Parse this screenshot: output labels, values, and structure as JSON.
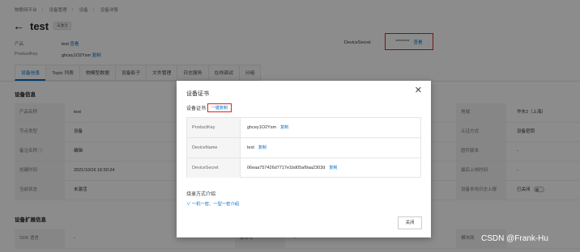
{
  "breadcrumb": [
    "物联网平台",
    "设备管理",
    "设备",
    "设备详情"
  ],
  "device": {
    "name": "test",
    "status": "未激活",
    "product_label": "产品",
    "product_value": "test",
    "product_link": "查看",
    "productkey_label": "ProductKey",
    "productkey_value": "ghcey1O2Ysm",
    "productkey_copy": "复制",
    "devicesecret_label": "DeviceSecret",
    "devicesecret_masked": "********",
    "devicesecret_view": "查看"
  },
  "tabs": [
    "设备信息",
    "Topic 列表",
    "物模型数据",
    "设备影子",
    "文件管理",
    "日志服务",
    "在线调试",
    "分组"
  ],
  "active_tab": 0,
  "section_info": {
    "title": "设备信息",
    "rows": [
      {
        "l1": "产品名称",
        "v1": "test",
        "l3": "地域",
        "v3": "华东2（上海）"
      },
      {
        "l1": "节点类型",
        "v1": "设备",
        "l3": "认证方式",
        "v3": "设备密钥"
      },
      {
        "l1": "备注名称",
        "v1": "编辑",
        "l3": "固件版本",
        "v3": "-"
      },
      {
        "l1": "创建时间",
        "v1": "2021/10/16 16:50:24",
        "l3": "最后上线时间",
        "v3": "-"
      },
      {
        "l1": "当前状态",
        "v1": "未激活",
        "l3": "设备本地日志上报",
        "v3": "已关闭"
      }
    ]
  },
  "section_ext": {
    "title": "设备扩展信息",
    "rows": [
      {
        "l1": "SDK 语言",
        "v1": "-",
        "l2": "版本号",
        "v2": "-",
        "l3": "模块商",
        "v3": ""
      }
    ]
  },
  "modal": {
    "title": "设备证书",
    "cert_label": "设备证书",
    "copy_all": "一键复制",
    "rows": [
      {
        "key": "ProductKey",
        "value": "ghcey1O2Ysm",
        "copy": "复制"
      },
      {
        "key": "DeviceName",
        "value": "test",
        "copy": "复制"
      },
      {
        "key": "DeviceSecret",
        "value": "06eaa757426d7717e1bd05af9aa2303d",
        "copy": "复制"
      }
    ],
    "burn_title": "烧录方式介绍",
    "burn_link": "一机一密、一型一密介绍",
    "close_button": "关闭"
  },
  "watermark": "CSDN @Frank-Hu",
  "colors": {
    "accent": "#0070cc",
    "highlight": "#e2231a"
  }
}
